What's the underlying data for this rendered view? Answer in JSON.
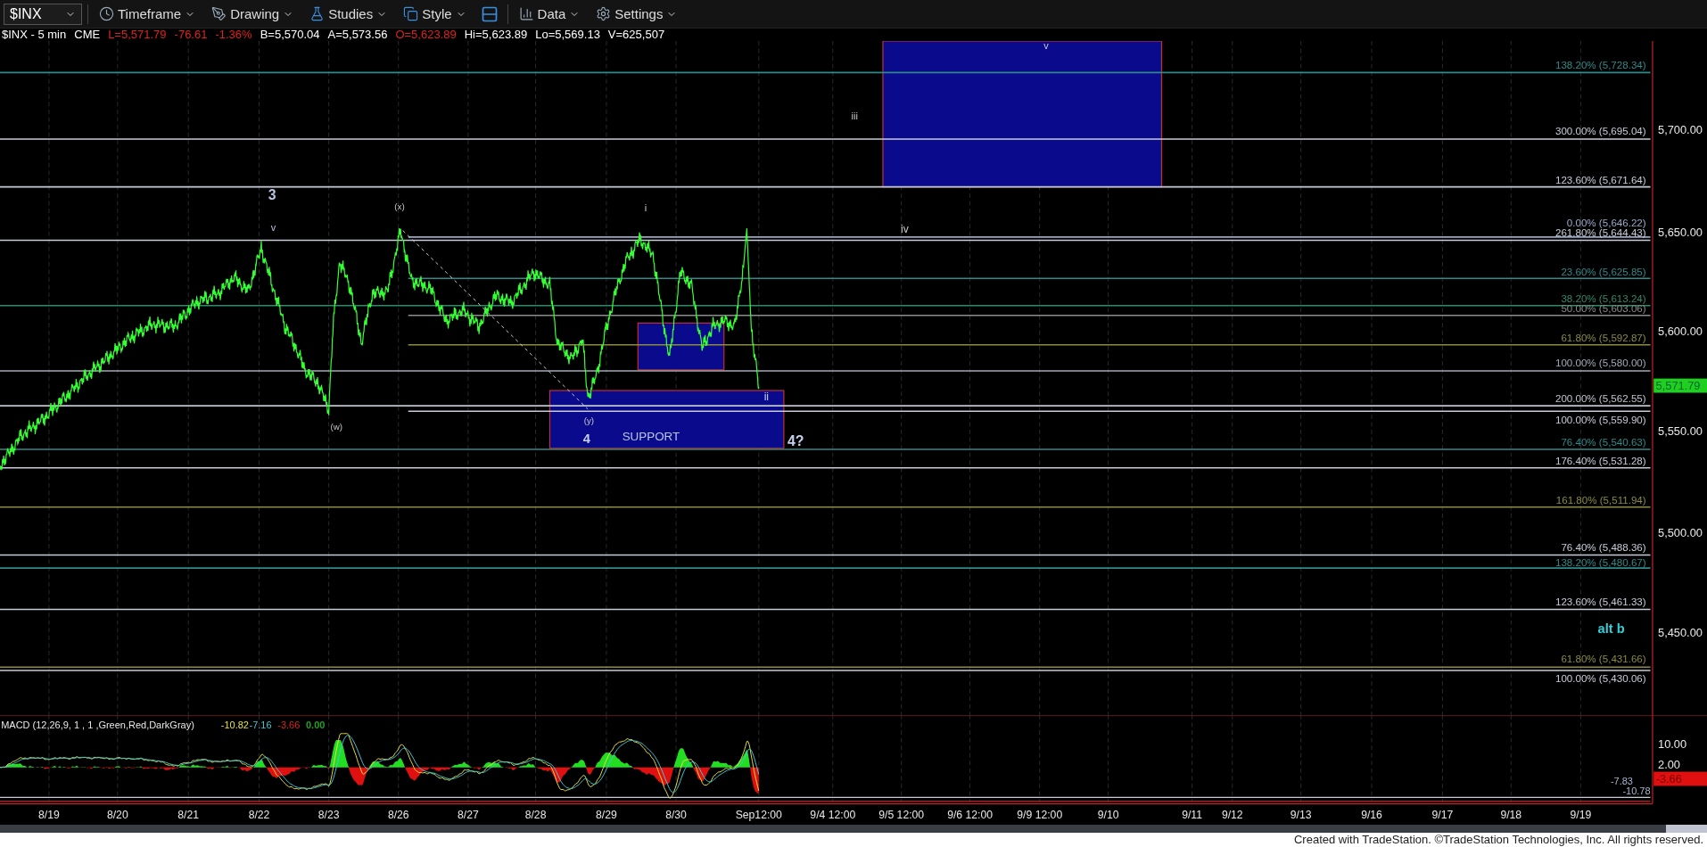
{
  "toolbar": {
    "symbol": "$INX",
    "menus": [
      {
        "label": "Timeframe",
        "kind": "clock"
      },
      {
        "label": "Drawing",
        "kind": "pen"
      },
      {
        "label": "Studies",
        "kind": "flask"
      },
      {
        "label": "Style",
        "kind": "style"
      },
      {
        "label": "Data",
        "kind": "bars"
      },
      {
        "label": "Settings",
        "kind": "gear"
      }
    ]
  },
  "quote": [
    {
      "text": "$INX - 5 min",
      "color": "#ffffff"
    },
    {
      "text": "CME",
      "color": "#ffffff"
    },
    {
      "text": "L=5,571.79",
      "color": "#e02020"
    },
    {
      "text": "-76.61",
      "color": "#e02020"
    },
    {
      "text": "-1.36%",
      "color": "#e02020"
    },
    {
      "text": "B=5,570.04",
      "color": "#ffffff"
    },
    {
      "text": "A=5,573.56",
      "color": "#ffffff"
    },
    {
      "text": "O=5,623.89",
      "color": "#e02020"
    },
    {
      "text": "Hi=5,623.89",
      "color": "#ffffff"
    },
    {
      "text": "Lo=5,569.13",
      "color": "#ffffff"
    },
    {
      "text": "V=625,507",
      "color": "#ffffff"
    }
  ],
  "fib_levels": [
    {
      "label": "138.20% (5,728.34)",
      "color": "#2f8a8a"
    },
    {
      "label": "300.00% (5,695.04)",
      "color": "#c8ccd8"
    },
    {
      "label": "123.60% (5,671.64)",
      "color": "#c8ccd8"
    },
    {
      "label": "0.00% (5,646.22)",
      "color": "#9aa8c8"
    },
    {
      "label": "261.80% (5,644.43)",
      "color": "#c8ccd8"
    },
    {
      "label": "23.60% (5,625.85)",
      "color": "#2f8a8a"
    },
    {
      "label": "38.20% (5,613.24)",
      "color": "#2f8a6a"
    },
    {
      "label": "50.00% (5,603.06)",
      "color": "#8c8c8c"
    },
    {
      "label": "61.80% (5,592.87)",
      "color": "#8c8c40"
    },
    {
      "label": "100.00% (5,580.00)",
      "color": "#a0a8b8"
    },
    {
      "label": "200.00% (5,562.55)",
      "color": "#c0c4cc"
    },
    {
      "label": "100.00% (5,559.90)",
      "color": "#c8ccd8"
    },
    {
      "label": "76.40% (5,540.63)",
      "color": "#2f8a8a"
    },
    {
      "label": "176.40% (5,531.28)",
      "color": "#c8ccd8"
    },
    {
      "label": "161.80% (5,511.94)",
      "color": "#8c8c40"
    },
    {
      "label": "76.40% (5,488.36)",
      "color": "#c8ccd8"
    },
    {
      "label": "138.20% (5,480.67)",
      "color": "#2f8a8a"
    },
    {
      "label": "123.60% (5,461.33)",
      "color": "#c8ccd8"
    },
    {
      "label": "61.80% (5,431.66)",
      "color": "#8c8c40"
    },
    {
      "label": "100.00% (5,430.06)",
      "color": "#c8ccd8"
    }
  ],
  "wave_labels": [
    "3",
    "v",
    "(x)",
    "(w)",
    "i",
    "(y)",
    "4",
    "SUPPORT",
    "ii",
    "4?",
    "iii",
    "iv",
    "v",
    "alt b"
  ],
  "price_axis": {
    "ticks": [
      "5,700.00",
      "5,650.00",
      "5,600.00",
      "5,550.00",
      "5,500.00",
      "5,450.00"
    ],
    "last_price": "5,571.79"
  },
  "macd": {
    "title": "MACD (12,26,9, 1 , 1 ,Green,Red,DarkGray)",
    "values": [
      {
        "text": "-10.82",
        "color": "#e8e040"
      },
      {
        "text": "-7.16",
        "color": "#40c8d8"
      },
      {
        "text": "-3.66",
        "color": "#e02020"
      },
      {
        "text": "0.00",
        "color": "#20a020"
      }
    ],
    "ticks": [
      "10.00",
      "2.00"
    ],
    "badge": "-3.66",
    "line_labels": [
      "-7.83",
      "-10.78"
    ]
  },
  "dates": [
    "8/19",
    "8/20",
    "8/21",
    "8/22",
    "8/23",
    "8/26",
    "8/27",
    "8/28",
    "8/29",
    "8/30",
    "Sep12:00",
    "9/4 12:00",
    "9/5 12:00",
    "9/6 12:00",
    "9/9 12:00",
    "9/10",
    "9/11",
    "9/12",
    "9/13",
    "9/16",
    "9/17",
    "9/18",
    "9/19"
  ],
  "footer": "Created with TradeStation. ©TradeStation Technologies, Inc. All rights reserved."
}
